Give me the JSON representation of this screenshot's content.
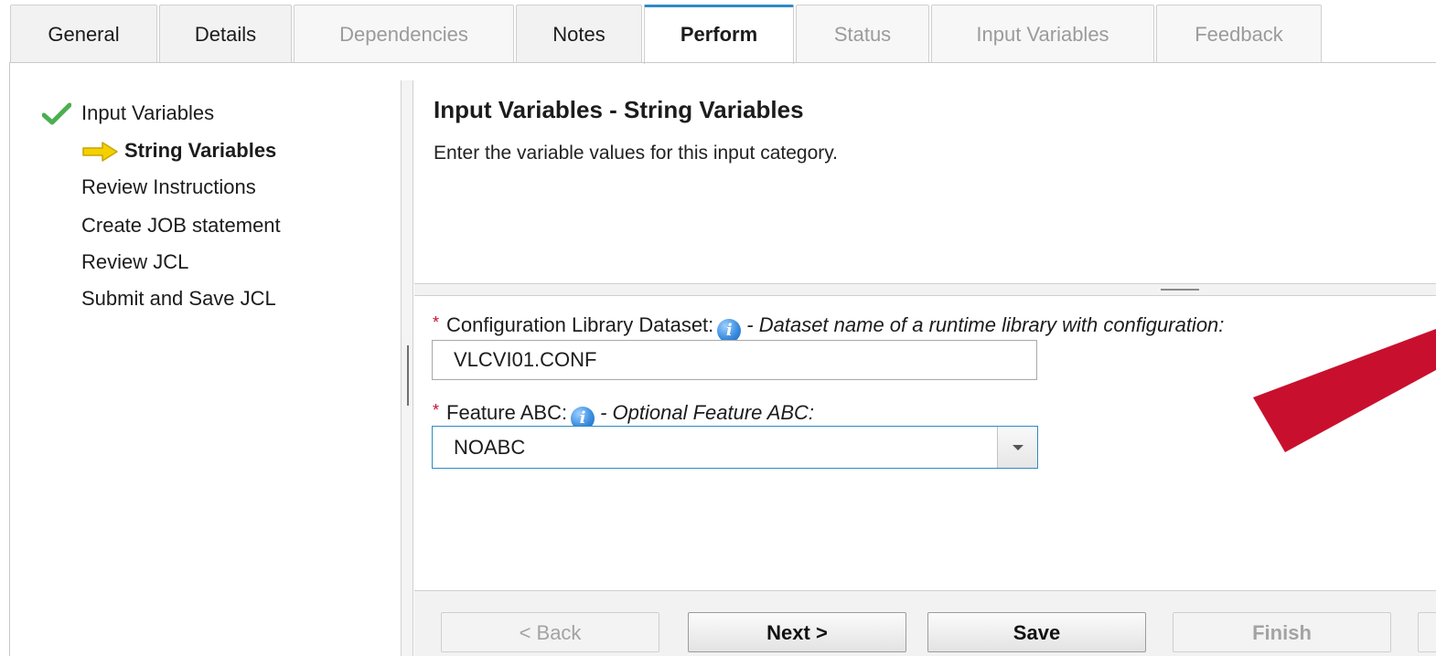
{
  "tabs": [
    {
      "label": "General",
      "state": "normal"
    },
    {
      "label": "Details",
      "state": "normal"
    },
    {
      "label": "Dependencies",
      "state": "disabled"
    },
    {
      "label": "Notes",
      "state": "normal"
    },
    {
      "label": "Perform",
      "state": "active"
    },
    {
      "label": "Status",
      "state": "disabled"
    },
    {
      "label": "Input Variables",
      "state": "disabled"
    },
    {
      "label": "Feedback",
      "state": "disabled"
    }
  ],
  "steps": [
    {
      "label": "Input Variables",
      "status": "completed"
    },
    {
      "label": "String Variables",
      "status": "current"
    },
    {
      "label": "Review Instructions",
      "status": "pending"
    },
    {
      "label": "Create JOB statement",
      "status": "pending"
    },
    {
      "label": "Review JCL",
      "status": "pending"
    },
    {
      "label": "Submit and Save JCL",
      "status": "pending"
    }
  ],
  "content": {
    "title": "Input Variables - String Variables",
    "subtitle": "Enter the variable values for this input category."
  },
  "fields": {
    "config_lib": {
      "required_mark": "*",
      "label": "Configuration Library Dataset:",
      "description": "- Dataset name of a runtime library with configuration:",
      "value": "VLCVI01.CONF"
    },
    "feature_abc": {
      "required_mark": "*",
      "label": "Feature ABC:",
      "description": "- Optional Feature ABC:",
      "value": "NOABC"
    }
  },
  "buttons": {
    "back": "< Back",
    "next": "Next >",
    "save": "Save",
    "finish": "Finish"
  },
  "colors": {
    "active_tab_accent": "#2e8ac4",
    "required_star": "#c8102e",
    "check_green": "#4caf50",
    "arrow_yellow": "#f5d000",
    "annotation_red": "#c8102e"
  },
  "icons": {
    "completed_step": "check-icon",
    "current_step": "arrow-right-icon",
    "help": "info-icon",
    "dropdown": "chevron-down-icon"
  }
}
